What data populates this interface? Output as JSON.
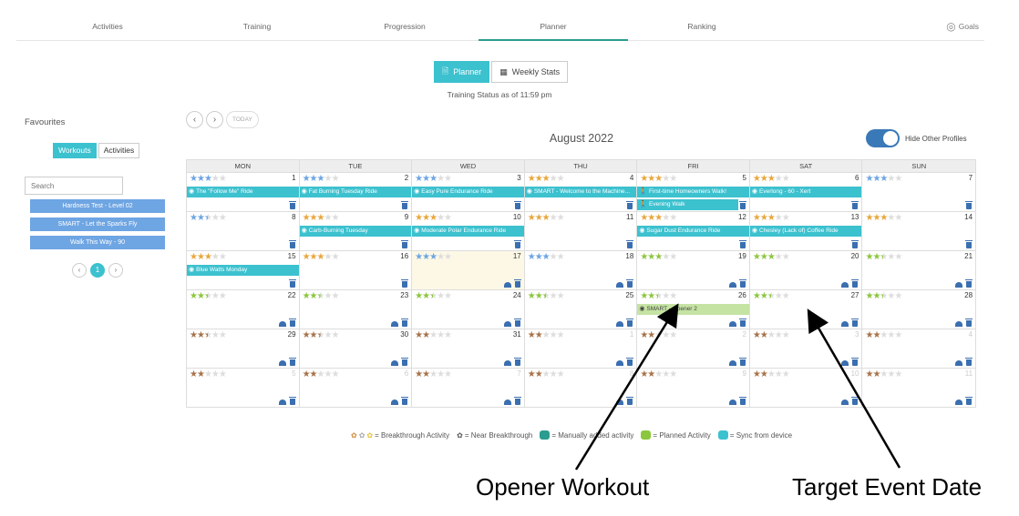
{
  "nav": {
    "tabs": [
      "Activities",
      "Training",
      "Progression",
      "Planner",
      "Ranking"
    ],
    "active": "Planner",
    "goals_label": "Goals"
  },
  "view": {
    "planner_label": "Planner",
    "weekly_label": "Weekly Stats"
  },
  "status_line": "Training Status as of 11:59 pm",
  "favourites": {
    "title": "Favourites",
    "tabs": [
      "Workouts",
      "Activities"
    ],
    "search_placeholder": "Search",
    "items": [
      "Hardness Test - Level 02",
      "SMART - Let the Sparks Fly",
      "Walk This Way - 90"
    ],
    "page": "1"
  },
  "calendar": {
    "today_label": "TODAY",
    "month": "August 2022",
    "toggle_label": "Hide Other Profiles",
    "days": [
      "MON",
      "TUE",
      "WED",
      "THU",
      "FRI",
      "SAT",
      "SUN"
    ],
    "weeks": [
      [
        {
          "n": "1",
          "s": [
            3,
            "b"
          ],
          "ev": [
            "The \"Follow Me\" Ride"
          ]
        },
        {
          "n": "2",
          "s": [
            3,
            "b"
          ],
          "ev": [
            "Fat Burning Tuesday Ride"
          ]
        },
        {
          "n": "3",
          "s": [
            3,
            "b"
          ],
          "ev": [
            "Easy Pure Endurance Ride"
          ]
        },
        {
          "n": "4",
          "s": [
            3,
            "o"
          ],
          "ev": [
            "SMART - Welcome to the Machine..."
          ]
        },
        {
          "n": "5",
          "s": [
            3,
            "o"
          ],
          "ev": [
            "First-time Homeowners Walk!",
            "Evening Walk"
          ]
        },
        {
          "n": "6",
          "s": [
            3,
            "o"
          ],
          "ev": [
            "Everlong - 60 - Xert"
          ]
        },
        {
          "n": "7",
          "s": [
            3,
            "b"
          ],
          "ev": []
        }
      ],
      [
        {
          "n": "8",
          "s": [
            2.5,
            "b"
          ],
          "ev": []
        },
        {
          "n": "9",
          "s": [
            3,
            "o"
          ],
          "ev": [
            "Carb-Burning Tuesday"
          ]
        },
        {
          "n": "10",
          "s": [
            3,
            "o"
          ],
          "ev": [
            "Moderate Polar Endurance Ride"
          ]
        },
        {
          "n": "11",
          "s": [
            3,
            "o"
          ],
          "ev": []
        },
        {
          "n": "12",
          "s": [
            3,
            "o"
          ],
          "ev": [
            "Sugar Dust Endurance Ride"
          ]
        },
        {
          "n": "13",
          "s": [
            3,
            "o"
          ],
          "ev": [
            "Chesley (Lack of) Coffee Ride"
          ]
        },
        {
          "n": "14",
          "s": [
            3,
            "o"
          ],
          "ev": []
        }
      ],
      [
        {
          "n": "15",
          "s": [
            3,
            "o"
          ],
          "ev": [
            "Blue Watts Monday"
          ]
        },
        {
          "n": "16",
          "s": [
            3,
            "o"
          ],
          "ev": []
        },
        {
          "n": "17",
          "s": [
            3,
            "b"
          ],
          "ev": [],
          "hl": true
        },
        {
          "n": "18",
          "s": [
            3,
            "b"
          ],
          "ev": []
        },
        {
          "n": "19",
          "s": [
            3,
            "g"
          ],
          "ev": []
        },
        {
          "n": "20",
          "s": [
            3,
            "g"
          ],
          "ev": []
        },
        {
          "n": "21",
          "s": [
            2.5,
            "g"
          ],
          "ev": []
        }
      ],
      [
        {
          "n": "22",
          "s": [
            2.5,
            "g"
          ],
          "ev": []
        },
        {
          "n": "23",
          "s": [
            2.5,
            "g"
          ],
          "ev": []
        },
        {
          "n": "24",
          "s": [
            2.5,
            "g"
          ],
          "ev": []
        },
        {
          "n": "25",
          "s": [
            2.5,
            "g"
          ],
          "ev": []
        },
        {
          "n": "26",
          "s": [
            2.5,
            "g"
          ],
          "ev": [
            "SMART - Opener 2"
          ],
          "planned": true
        },
        {
          "n": "27",
          "s": [
            2.5,
            "g"
          ],
          "ev": []
        },
        {
          "n": "28",
          "s": [
            2.5,
            "g"
          ],
          "ev": []
        }
      ],
      [
        {
          "n": "29",
          "s": [
            2.5,
            "br"
          ],
          "ev": []
        },
        {
          "n": "30",
          "s": [
            2.5,
            "br"
          ],
          "ev": []
        },
        {
          "n": "31",
          "s": [
            2,
            "br"
          ],
          "ev": []
        },
        {
          "n": "1",
          "s": [
            2,
            "br"
          ],
          "ev": [],
          "m": true
        },
        {
          "n": "2",
          "s": [
            2,
            "br"
          ],
          "ev": [],
          "m": true
        },
        {
          "n": "3",
          "s": [
            2,
            "br"
          ],
          "ev": [],
          "m": true
        },
        {
          "n": "4",
          "s": [
            2,
            "br"
          ],
          "ev": [],
          "m": true
        }
      ],
      [
        {
          "n": "5",
          "s": [
            2,
            "br"
          ],
          "ev": [],
          "m": true
        },
        {
          "n": "6",
          "s": [
            2,
            "br"
          ],
          "ev": [],
          "m": true
        },
        {
          "n": "7",
          "s": [
            2,
            "br"
          ],
          "ev": [],
          "m": true
        },
        {
          "n": "8",
          "s": [
            2,
            "br"
          ],
          "ev": [],
          "m": true
        },
        {
          "n": "9",
          "s": [
            2,
            "br"
          ],
          "ev": [],
          "m": true
        },
        {
          "n": "10",
          "s": [
            2,
            "br"
          ],
          "ev": [],
          "m": true
        },
        {
          "n": "11",
          "s": [
            2,
            "br"
          ],
          "ev": [],
          "m": true
        }
      ]
    ]
  },
  "legend": {
    "breakthrough": "= Breakthrough Activity",
    "near": "= Near Breakthrough",
    "manual": "= Manually added activity",
    "planned": "= Planned Activity",
    "sync": "= Sync from device"
  },
  "annotations": {
    "opener": "Opener Workout",
    "target": "Target Event Date"
  },
  "colors": {
    "accent": "#3cc1cf",
    "blue_star": "#6ea5e3",
    "orange_star": "#e9a73c",
    "green_star": "#8cc63f",
    "brown_star": "#a8734a",
    "planned": "#c5e3a3"
  }
}
